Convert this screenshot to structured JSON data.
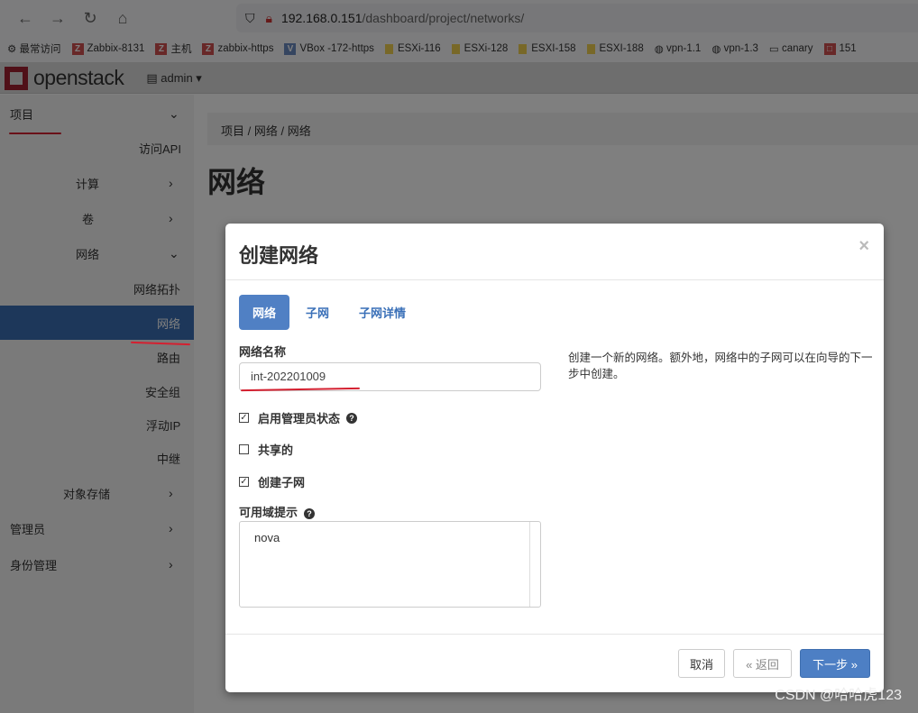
{
  "browser": {
    "url_host": "192.168.0.151",
    "url_path": "/dashboard/project/networks/",
    "bookmarks": [
      "最常访问",
      "Zabbix-8131",
      "主机",
      "zabbix-https",
      "VBox -172-https",
      "ESXi-116",
      "ESXi-128",
      "ESXI-158",
      "ESXI-188",
      "vpn-1.1",
      "vpn-1.3",
      "canary",
      "151"
    ]
  },
  "topbar": {
    "logo": "openstack",
    "project": "admin"
  },
  "sidebar": {
    "items": [
      {
        "label": "项目"
      },
      {
        "label": "访问API"
      },
      {
        "label": "计算"
      },
      {
        "label": "卷"
      },
      {
        "label": "网络"
      },
      {
        "label": "网络拓扑"
      },
      {
        "label": "网络"
      },
      {
        "label": "路由"
      },
      {
        "label": "安全组"
      },
      {
        "label": "浮动IP"
      },
      {
        "label": "中继"
      },
      {
        "label": "对象存储"
      },
      {
        "label": "管理员"
      },
      {
        "label": "身份管理"
      }
    ]
  },
  "breadcrumb": [
    "项目",
    "网络",
    "网络"
  ],
  "page_title": "网络",
  "modal": {
    "title": "创建网络",
    "close": "×",
    "tabs": [
      "网络",
      "子网",
      "子网详情"
    ],
    "name_label": "网络名称",
    "name_value": "int-202201009",
    "admin_state_label": "启用管理员状态",
    "admin_state_checked": true,
    "shared_label": "共享的",
    "shared_checked": false,
    "create_subnet_label": "创建子网",
    "create_subnet_checked": true,
    "az_label": "可用域提示",
    "az_options": [
      "nova"
    ],
    "help": "创建一个新的网络。额外地，网络中的子网可以在向导的下一步中创建。",
    "cancel": "取消",
    "back": "« 返回",
    "next": "下一步 »"
  },
  "watermark": "CSDN @哈哈虎123",
  "colors": {
    "primary": "#5080c4",
    "annotation": "#d42030"
  }
}
